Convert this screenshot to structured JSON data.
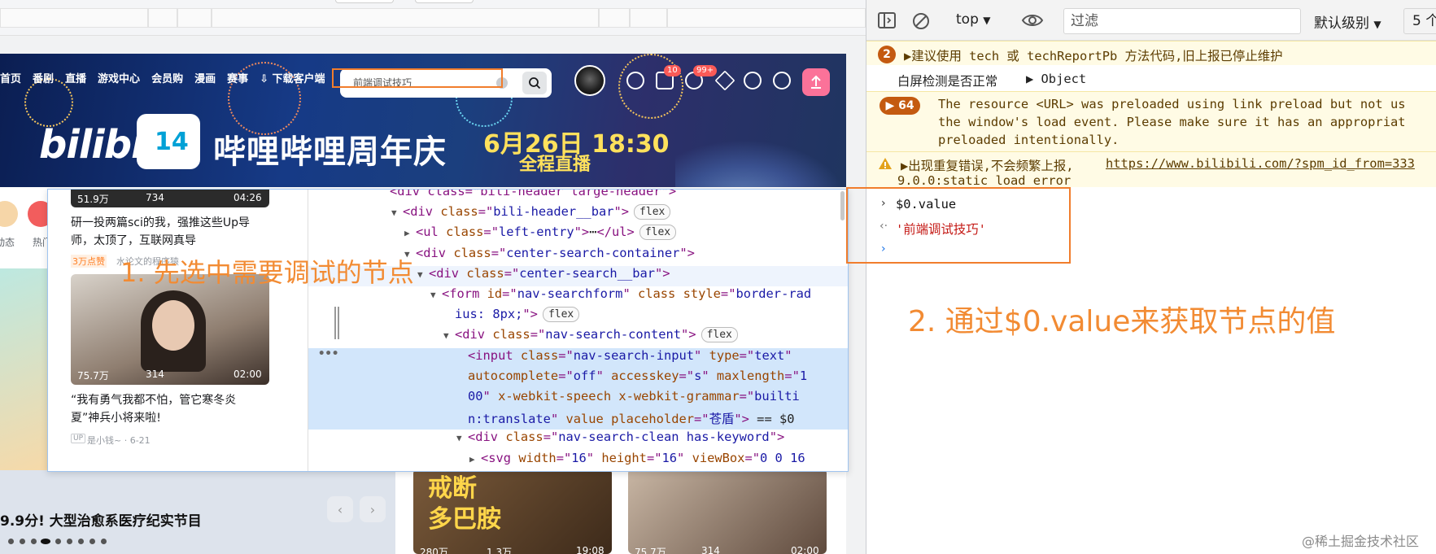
{
  "header": {
    "nav": [
      "首页",
      "番剧",
      "直播",
      "游戏中心",
      "会员购",
      "漫画",
      "赛事",
      "下载客户端"
    ],
    "search_value": "前端调试技巧",
    "badges": [
      "10",
      "99+"
    ]
  },
  "banner": {
    "logo": "bilibili",
    "anniversary": "14",
    "title": "哔哩哔哩周年庆",
    "date": "6月26日 18:30",
    "subtitle": "全程直播"
  },
  "feed": {
    "side_labels": [
      "动态",
      "热门"
    ],
    "cards": [
      {
        "plays": "51.9万",
        "danmaku": "734",
        "duration": "04:26",
        "title": "研一投两篇sci的我，强推这些Up导师，太顶了，互联网真导",
        "badge": "3万点赞",
        "author": "水论文的程序猿"
      },
      {
        "plays": "75.7万",
        "danmaku": "314",
        "duration": "02:00",
        "title": "“我有勇气我都不怕，管它寒冬炎夏”神兵小将来啦!",
        "badge": "UP",
        "author": "是小钱~ · 6-21"
      }
    ],
    "promo_title": "9.9分! 大型治愈系医疗纪实节目",
    "bottom_cards": [
      {
        "big_text": "戒断\n多巴胺",
        "plays": "280万",
        "danmaku": "1.3万",
        "duration": "19:08"
      },
      {
        "plays": "75.7万",
        "danmaku": "314",
        "duration": "02:00"
      }
    ]
  },
  "elements": {
    "lines": [
      {
        "indent": 0,
        "tri": "",
        "html_parts": [
          [
            "pun",
            "<div class=\"bili-header large-header\">"
          ]
        ]
      },
      {
        "indent": 1,
        "tri": "▼",
        "parts": [
          [
            "tag",
            "<div "
          ],
          [
            "an",
            "class"
          ],
          [
            "pun",
            "=\""
          ],
          [
            "av",
            "bili-header__bar"
          ],
          [
            "pun",
            "\">"
          ]
        ],
        "chip": "flex"
      },
      {
        "indent": 2,
        "tri": "▶",
        "parts": [
          [
            "tag",
            "<ul "
          ],
          [
            "an",
            "class"
          ],
          [
            "pun",
            "=\""
          ],
          [
            "av",
            "left-entry"
          ],
          [
            "pun",
            "\">"
          ],
          [
            "txt",
            "⋯"
          ],
          [
            "pun",
            "</ul>"
          ]
        ],
        "chip": "flex"
      },
      {
        "indent": 2,
        "tri": "▼",
        "parts": [
          [
            "tag",
            "<div "
          ],
          [
            "an",
            "class"
          ],
          [
            "pun",
            "=\""
          ],
          [
            "av",
            "center-search-container"
          ],
          [
            "pun",
            "\">"
          ]
        ]
      },
      {
        "indent": 3,
        "tri": "▼",
        "parts": [
          [
            "tag",
            "<div "
          ],
          [
            "an",
            "class"
          ],
          [
            "pun",
            "=\""
          ],
          [
            "av",
            "center-search__bar"
          ],
          [
            "pun",
            "\">"
          ]
        ]
      },
      {
        "indent": 4,
        "tri": "▼",
        "parts": [
          [
            "tag",
            "<form "
          ],
          [
            "an",
            "id"
          ],
          [
            "pun",
            "=\""
          ],
          [
            "av",
            "nav-searchform"
          ],
          [
            "pun",
            "\" "
          ],
          [
            "an",
            "class style"
          ],
          [
            "pun",
            "=\""
          ],
          [
            "av",
            "border-rad"
          ]
        ]
      },
      {
        "indent": 5,
        "tri": "",
        "parts": [
          [
            "av",
            "ius: 8px;"
          ],
          [
            "pun",
            "\">"
          ]
        ],
        "chip": "flex"
      },
      {
        "indent": 5,
        "tri": "▼",
        "parts": [
          [
            "tag",
            "<div "
          ],
          [
            "an",
            "class"
          ],
          [
            "pun",
            "=\""
          ],
          [
            "av",
            "nav-search-content"
          ],
          [
            "pun",
            "\">"
          ]
        ],
        "chip": "flex"
      },
      {
        "indent": 6,
        "tri": "",
        "parts": [
          [
            "tag",
            "<input "
          ],
          [
            "an",
            "class"
          ],
          [
            "pun",
            "=\""
          ],
          [
            "av",
            "nav-search-input"
          ],
          [
            "pun",
            "\" "
          ],
          [
            "an",
            "type"
          ],
          [
            "pun",
            "=\""
          ],
          [
            "av",
            "text"
          ],
          [
            "pun",
            "\""
          ]
        ]
      },
      {
        "indent": 6,
        "tri": "",
        "parts": [
          [
            "an",
            "autocomplete"
          ],
          [
            "pun",
            "=\""
          ],
          [
            "av",
            "off"
          ],
          [
            "pun",
            "\" "
          ],
          [
            "an",
            "accesskey"
          ],
          [
            "pun",
            "=\""
          ],
          [
            "av",
            "s"
          ],
          [
            "pun",
            "\" "
          ],
          [
            "an",
            "maxlength"
          ],
          [
            "pun",
            "=\""
          ],
          [
            "av",
            "1"
          ]
        ]
      },
      {
        "indent": 6,
        "tri": "",
        "parts": [
          [
            "av",
            "00"
          ],
          [
            "pun",
            "\" "
          ],
          [
            "an",
            "x-webkit-speech x-webkit-grammar"
          ],
          [
            "pun",
            "=\""
          ],
          [
            "av",
            "builti"
          ]
        ]
      },
      {
        "indent": 6,
        "tri": "",
        "parts": [
          [
            "av",
            "n:translate"
          ],
          [
            "pun",
            "\" "
          ],
          [
            "an",
            "value placeholder"
          ],
          [
            "pun",
            "=\""
          ],
          [
            "av",
            "苍盾"
          ],
          [
            "pun",
            "\">"
          ],
          [
            "txt",
            " == $0"
          ]
        ]
      },
      {
        "indent": 6,
        "tri": "▼",
        "parts": [
          [
            "tag",
            "<div "
          ],
          [
            "an",
            "class"
          ],
          [
            "pun",
            "=\""
          ],
          [
            "av",
            "nav-search-clean has-keyword"
          ],
          [
            "pun",
            "\">"
          ]
        ]
      },
      {
        "indent": 7,
        "tri": "▶",
        "parts": [
          [
            "tag",
            "<svg "
          ],
          [
            "an",
            "width"
          ],
          [
            "pun",
            "=\""
          ],
          [
            "av",
            "16"
          ],
          [
            "pun",
            "\" "
          ],
          [
            "an",
            "height"
          ],
          [
            "pun",
            "=\""
          ],
          [
            "av",
            "16"
          ],
          [
            "pun",
            "\" "
          ],
          [
            "an",
            "viewBox"
          ],
          [
            "pun",
            "=\""
          ],
          [
            "av",
            "0 0 16"
          ]
        ]
      }
    ]
  },
  "annotations": {
    "step1": "1. 先选中需要调试的节点",
    "step2": "2. 通过$0.value来获取节点的值"
  },
  "console": {
    "context": "top",
    "filter_placeholder": "过滤",
    "level": "默认级别",
    "issues": "5 个",
    "messages": [
      {
        "count": "2",
        "text": "▶建议使用 tech 或 techReportPb 方法代码,旧上报已停止维护"
      },
      {
        "text": "白屏检测是否正常",
        "obj": "▶ Object"
      },
      {
        "count": "▶ 64",
        "lines": [
          "The resource <URL> was preloaded using link preload but not us",
          "the window's load event. Please make sure it has an appropriat",
          "preloaded intentionally."
        ]
      },
      {
        "text": "▶出现重复错误,不会频繁上报,",
        "link": "https://www.bilibili.com/?spm_id_from=333",
        "line2": "9.0.0:static load error"
      }
    ],
    "input": "$0.value",
    "result": "'前端调试技巧'"
  },
  "watermark": "@稀土掘金技术社区"
}
